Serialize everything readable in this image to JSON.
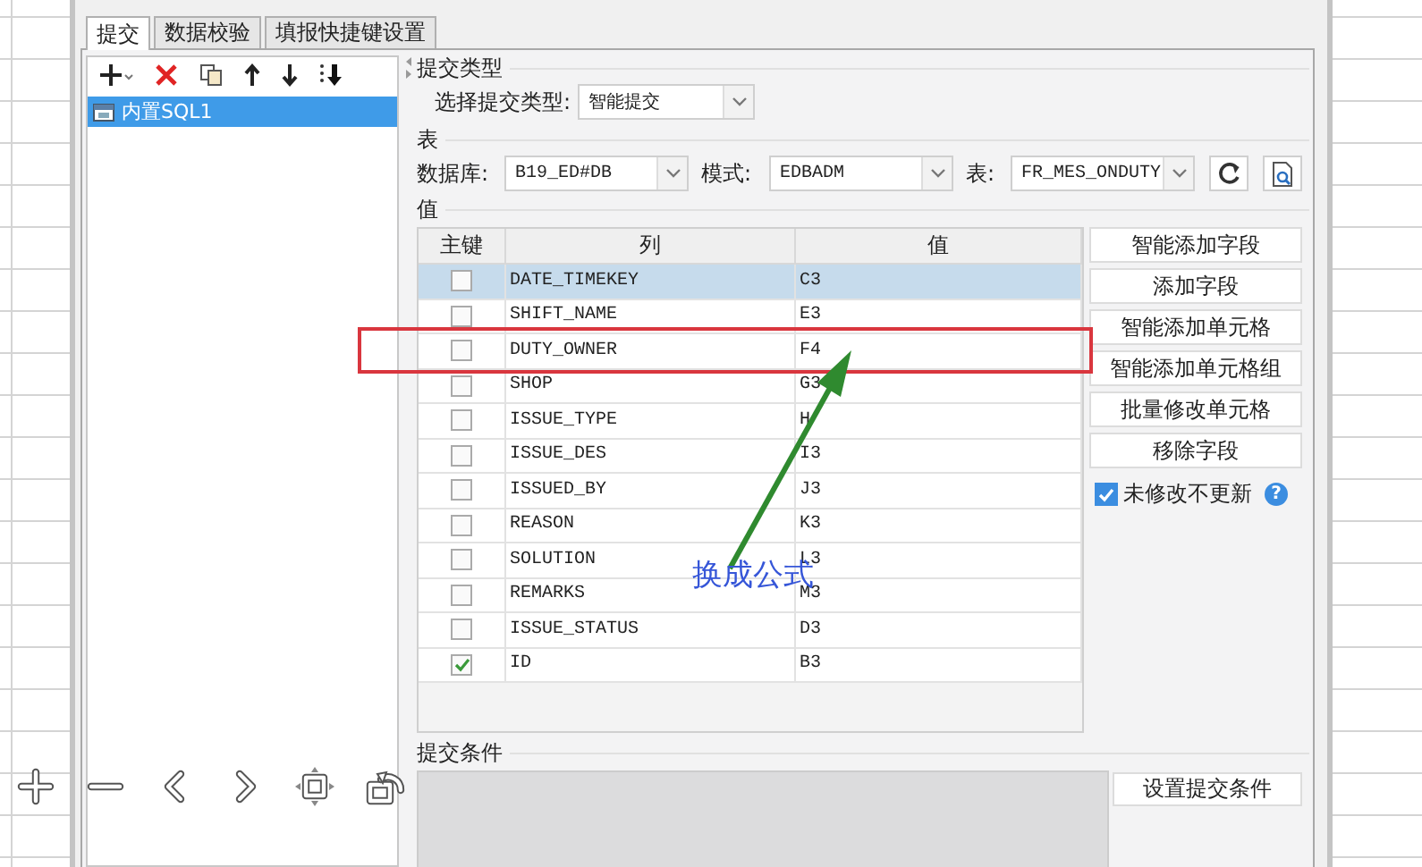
{
  "tabs": [
    {
      "label": "提交",
      "selected": true
    },
    {
      "label": "数据校验",
      "selected": false
    },
    {
      "label": "填报快捷键设置",
      "selected": false
    }
  ],
  "sql_list": {
    "items": [
      {
        "label": "内置SQL1",
        "selected": true
      }
    ]
  },
  "submit_type": {
    "heading": "提交类型",
    "label": "选择提交类型:",
    "value": "智能提交"
  },
  "table_section": {
    "heading": "表",
    "database_label": "数据库:",
    "database": "B19_ED#DB",
    "schema_label": "模式:",
    "schema": "EDBADM",
    "table_label": "表:",
    "table": "FR_MES_ONDUTY"
  },
  "values": {
    "heading": "值",
    "columns": [
      "主键",
      "列",
      "值"
    ],
    "rows": [
      {
        "primary_key": false,
        "column": "DATE_TIMEKEY",
        "value": "C3",
        "selected": true
      },
      {
        "primary_key": false,
        "column": "SHIFT_NAME",
        "value": "E3",
        "selected": false
      },
      {
        "primary_key": false,
        "column": "DUTY_OWNER",
        "value": "F4",
        "selected": false
      },
      {
        "primary_key": false,
        "column": "SHOP",
        "value": "G3",
        "selected": false
      },
      {
        "primary_key": false,
        "column": "ISSUE_TYPE",
        "value": "H",
        "selected": false
      },
      {
        "primary_key": false,
        "column": "ISSUE_DES",
        "value": "I3",
        "selected": false
      },
      {
        "primary_key": false,
        "column": "ISSUED_BY",
        "value": "J3",
        "selected": false
      },
      {
        "primary_key": false,
        "column": "REASON",
        "value": "K3",
        "selected": false
      },
      {
        "primary_key": false,
        "column": "SOLUTION",
        "value": "L3",
        "selected": false
      },
      {
        "primary_key": false,
        "column": "REMARKS",
        "value": "M3",
        "selected": false
      },
      {
        "primary_key": false,
        "column": "ISSUE_STATUS",
        "value": "D3",
        "selected": false
      },
      {
        "primary_key": true,
        "column": "ID",
        "value": "B3",
        "selected": false
      }
    ]
  },
  "side_buttons": [
    "智能添加字段",
    "添加字段",
    "智能添加单元格",
    "智能添加单元格组",
    "批量修改单元格",
    "移除字段"
  ],
  "skip_unchanged": {
    "label": "未修改不更新",
    "checked": true,
    "help": "?"
  },
  "conditions": {
    "heading": "提交条件",
    "button": "设置提交条件"
  },
  "annotation": {
    "text": "换成公式"
  }
}
